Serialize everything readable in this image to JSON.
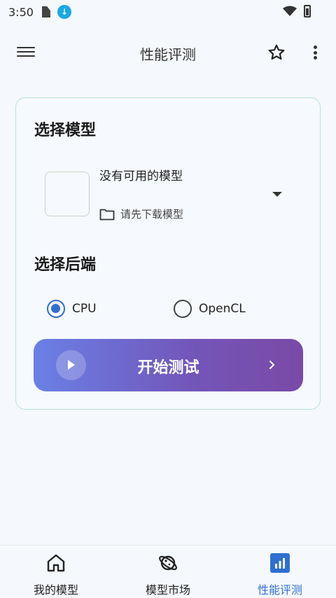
{
  "status_bar": {
    "time": "3:50"
  },
  "app_bar": {
    "title": "性能评测"
  },
  "model_section": {
    "title": "选择模型",
    "model_name": "没有可用的模型",
    "hint": "请先下载模型"
  },
  "backend_section": {
    "title": "选择后端",
    "options": [
      {
        "label": "CPU",
        "checked": true
      },
      {
        "label": "OpenCL",
        "checked": false
      }
    ]
  },
  "start_button": {
    "label": "开始测试"
  },
  "bottom_nav": {
    "items": [
      {
        "label": "我的模型",
        "icon": "home-icon"
      },
      {
        "label": "模型市场",
        "icon": "planet-icon"
      },
      {
        "label": "性能评测",
        "icon": "chart-icon",
        "active": true
      }
    ]
  },
  "colors": {
    "accent": "#2f6fd1",
    "card_border": "#b5e3d8",
    "gradient_start": "#6a80e6",
    "gradient_end": "#7a4aa6"
  }
}
